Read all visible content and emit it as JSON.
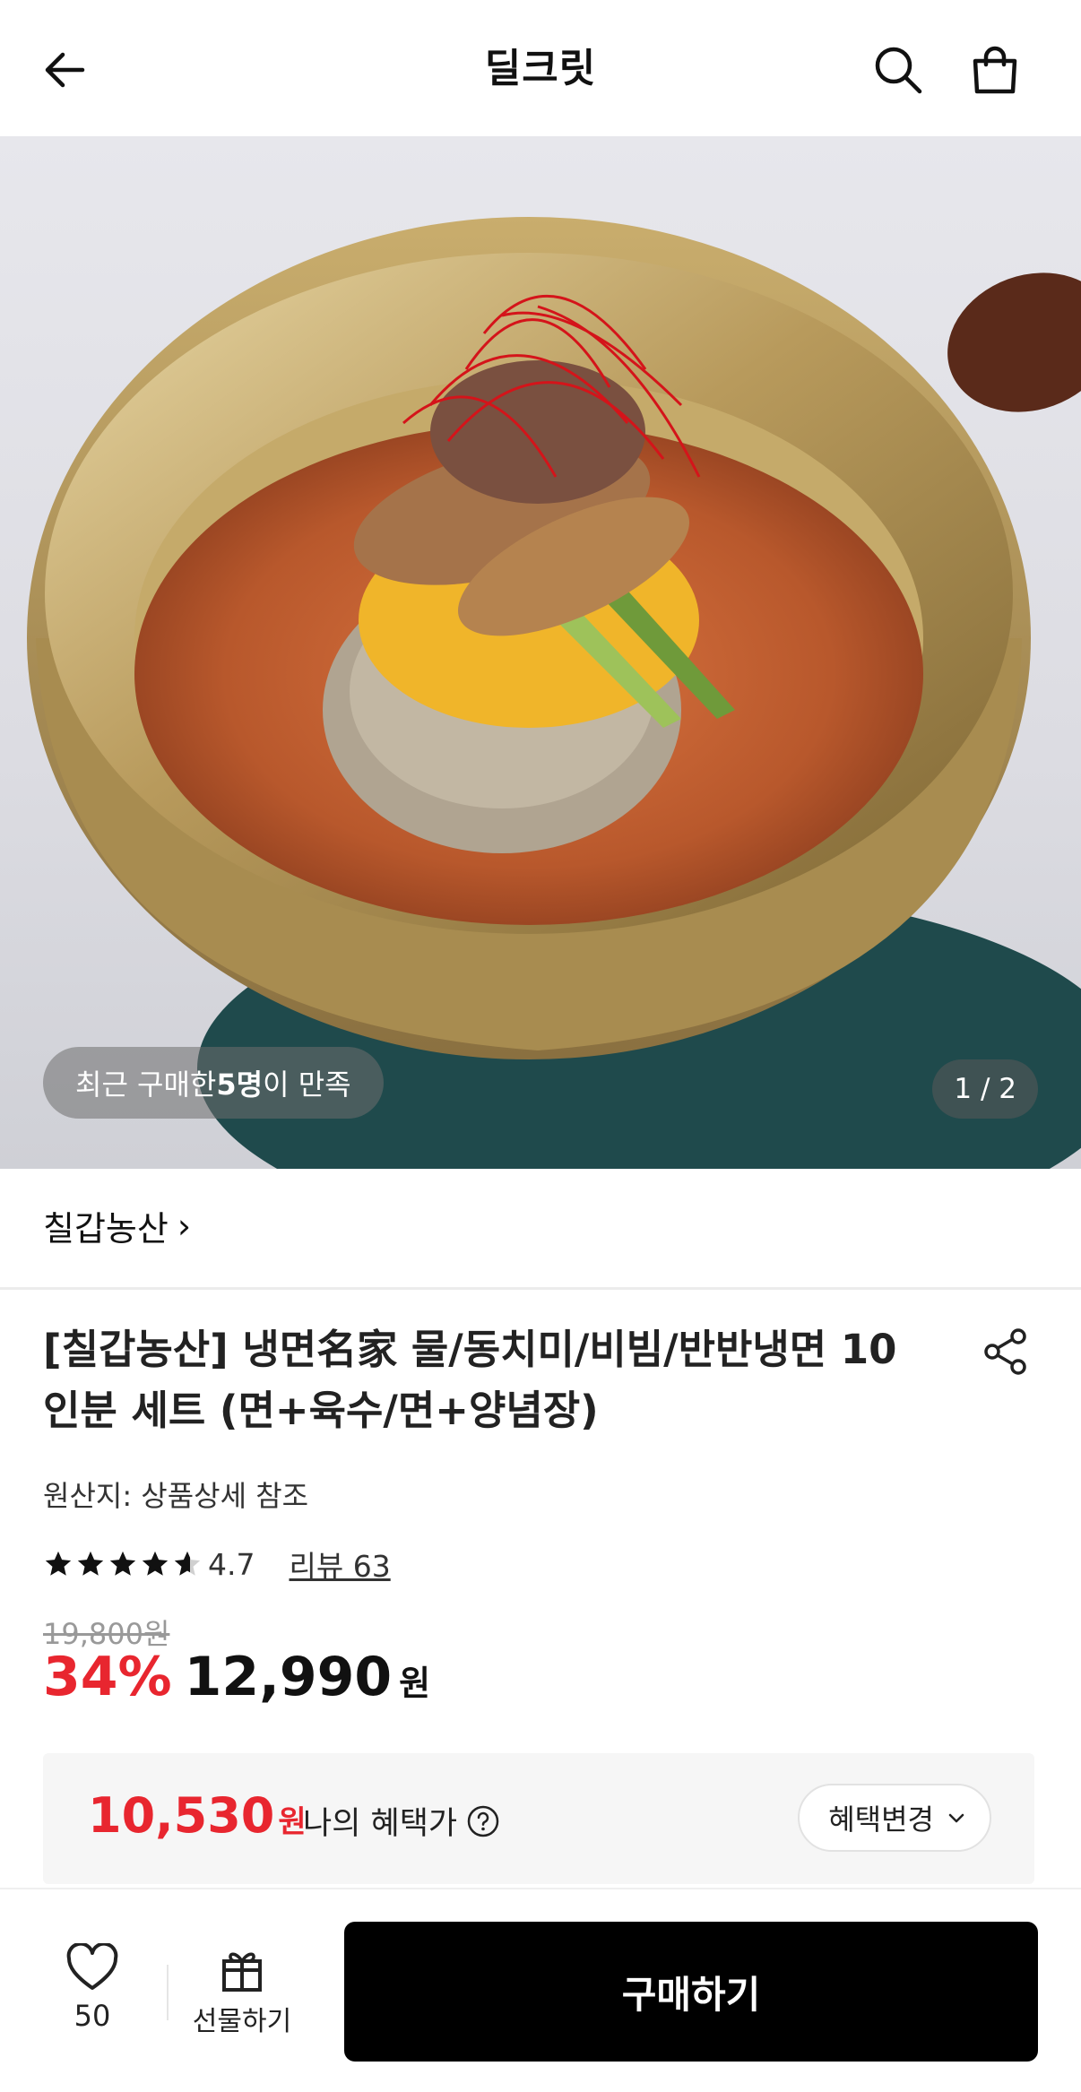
{
  "header": {
    "title": "딜크릿",
    "back_icon": "arrow-left-icon",
    "search_icon": "search-icon",
    "cart_icon": "shopping-bag-icon"
  },
  "hero": {
    "satisfy_prefix": "최근 구매한 ",
    "satisfy_count": "5명",
    "satisfy_suffix": "이 만족",
    "counter": "1 / 2"
  },
  "seller": {
    "name": "칠갑농산",
    "chevron": "›"
  },
  "product": {
    "title": "[칠갑농산] 냉면名家 물/동치미/비빔/반반냉면 10인분 세트 (면+육수/면+양념장)",
    "origin": "원산지: 상품상세 참조",
    "rating": "4.7",
    "rating_stars": 4.7,
    "review_link": "리뷰 63",
    "original_price": "19,800원",
    "discount": "34%",
    "price": "12,990",
    "price_unit": "원"
  },
  "benefit": {
    "price": "10,530",
    "price_unit": "원",
    "label": "나의 혜택가",
    "help_icon": "question-circle-icon",
    "change_label": "혜택변경"
  },
  "bottom": {
    "wish_count": "50",
    "gift_label": "선물하기",
    "buy_label": "구매하기"
  },
  "colors": {
    "accent_red": "#e8262f",
    "buy_button": "#000000"
  }
}
